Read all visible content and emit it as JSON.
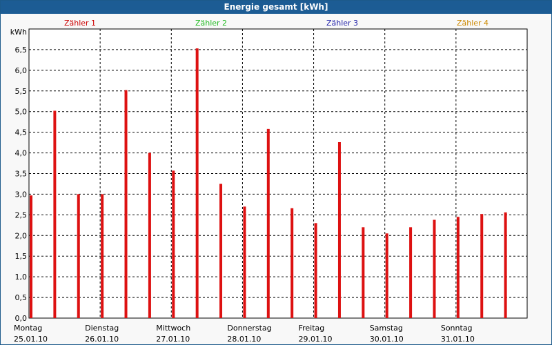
{
  "chart_data": {
    "type": "bar",
    "title": "Energie gesamt [kWh]",
    "ylabel": "kWh",
    "ylim": [
      0,
      7
    ],
    "yticks": [
      "0,0",
      "0,5",
      "1,0",
      "1,5",
      "2,0",
      "2,5",
      "3,0",
      "3,5",
      "4,0",
      "4,5",
      "5,0",
      "5,5",
      "6,0",
      "6,5"
    ],
    "grid": true,
    "legend": [
      {
        "name": "Zähler 1",
        "color": "#cc0000"
      },
      {
        "name": "Zähler 2",
        "color": "#22bb22"
      },
      {
        "name": "Zähler 3",
        "color": "#2222aa"
      },
      {
        "name": "Zähler 4",
        "color": "#cc8800"
      }
    ],
    "days": [
      {
        "day": "Montag",
        "date": "25.01.10"
      },
      {
        "day": "Dienstag",
        "date": "26.01.10"
      },
      {
        "day": "Mittwoch",
        "date": "27.01.10"
      },
      {
        "day": "Donnerstag",
        "date": "28.01.10"
      },
      {
        "day": "Freitag",
        "date": "29.01.10"
      },
      {
        "day": "Samstag",
        "date": "30.01.10"
      },
      {
        "day": "Sonntag",
        "date": "31.01.10"
      }
    ],
    "bar_color": "#dd1111",
    "values": [
      2.97,
      5.02,
      3.0,
      3.0,
      5.52,
      4.0,
      3.57,
      6.53,
      3.25,
      2.7,
      4.58,
      2.66,
      2.3,
      4.26,
      2.2,
      2.05,
      2.2,
      2.38,
      2.45,
      2.52,
      2.56
    ]
  }
}
